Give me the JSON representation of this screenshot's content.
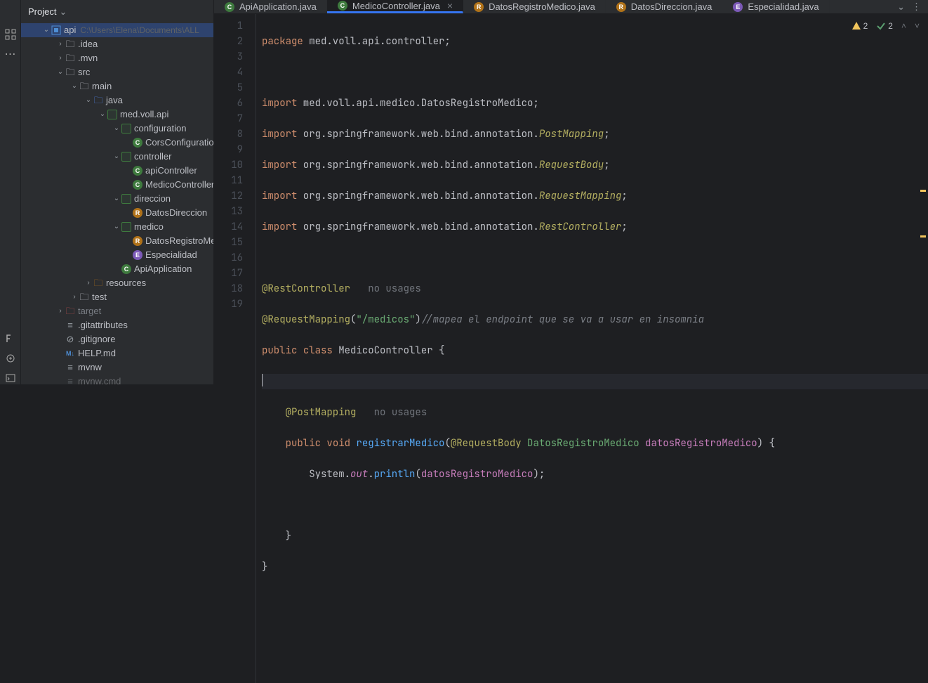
{
  "sidebar": {
    "title": "Project",
    "root": {
      "name": "api",
      "hint": "C:\\Users\\Elena\\Documents\\ALL"
    },
    "items": [
      {
        "name": ".idea"
      },
      {
        "name": ".mvn"
      },
      {
        "name": "src"
      },
      {
        "name": "main"
      },
      {
        "name": "java"
      },
      {
        "name": "med.voll.api"
      },
      {
        "name": "configuration"
      },
      {
        "name": "CorsConfiguration"
      },
      {
        "name": "controller"
      },
      {
        "name": "apiController"
      },
      {
        "name": "MedicoController"
      },
      {
        "name": "direccion"
      },
      {
        "name": "DatosDireccion"
      },
      {
        "name": "medico"
      },
      {
        "name": "DatosRegistroMe"
      },
      {
        "name": "Especialidad"
      },
      {
        "name": "ApiApplication"
      },
      {
        "name": "resources"
      },
      {
        "name": "test"
      },
      {
        "name": "target"
      },
      {
        "name": ".gitattributes"
      },
      {
        "name": ".gitignore"
      },
      {
        "name": "HELP.md"
      },
      {
        "name": "mvnw"
      },
      {
        "name": "mvnw.cmd"
      }
    ]
  },
  "tabs": [
    {
      "label": "ApiApplication.java",
      "active": false
    },
    {
      "label": "MedicoController.java",
      "active": true
    },
    {
      "label": "DatosRegistroMedico.java",
      "active": false
    },
    {
      "label": "DatosDireccion.java",
      "active": false
    },
    {
      "label": "Especialidad.java",
      "active": false
    }
  ],
  "inspections": {
    "warnings": "2",
    "checks": "2"
  },
  "code": {
    "l1_kw": "package",
    "l1_rest": " med.voll.api.controller;",
    "l3_kw": "import",
    "l3_rest": " med.voll.api.medico.DatosRegistroMedico;",
    "l4_kw": "import",
    "l4_pkg": " org.springframework.web.bind.annotation.",
    "l4_cls": "PostMapping",
    "l4_end": ";",
    "l5_kw": "import",
    "l5_pkg": " org.springframework.web.bind.annotation.",
    "l5_cls": "RequestBody",
    "l5_end": ";",
    "l6_kw": "import",
    "l6_pkg": " org.springframework.web.bind.annotation.",
    "l6_cls": "RequestMapping",
    "l6_end": ";",
    "l7_kw": "import",
    "l7_pkg": " org.springframework.web.bind.annotation.",
    "l7_cls": "RestController",
    "l7_end": ";",
    "l9_ann": "@RestController",
    "l9_hint": "   no usages",
    "l10_ann": "@RequestMapping",
    "l10_paren": "(",
    "l10_str": "\"/medicos\"",
    "l10_paren2": ")",
    "l10_cmt": "//mapea el endpoint que se va a usar en insomnia",
    "l11_kw": "public",
    "l11_kw2": "class",
    "l11_name": " MedicoController {",
    "l13_ann": "@PostMapping",
    "l13_hint": "   no usages",
    "l14_kw": "public",
    "l14_kw2": "void",
    "l14_fn": " registrarMedico",
    "l14_p1": "(",
    "l14_ann": "@RequestBody",
    "l14_type": " DatosRegistroMedico",
    "l14_par": " datosRegistroMedico",
    "l14_p2": ") {",
    "l15_a": "        System.",
    "l15_b": "out",
    "l15_c": ".",
    "l15_d": "println",
    "l15_e": "(",
    "l15_f": "datosRegistroMedico",
    "l15_g": ");",
    "l17": "    }",
    "l18": "}"
  }
}
